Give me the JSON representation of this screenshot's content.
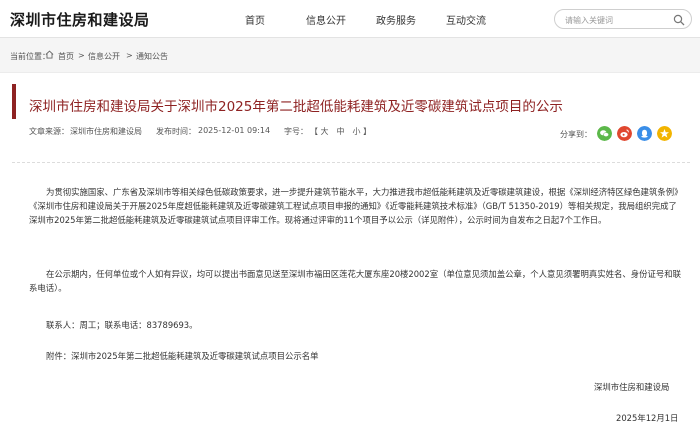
{
  "header": {
    "site_title": "深圳市住房和建设局",
    "nav": [
      "首页",
      "信息公开",
      "政务服务",
      "互动交流"
    ],
    "search_placeholder": "请输入关键词"
  },
  "breadcrumb": {
    "label": "当前位置：",
    "items": [
      "首页",
      "信息公开",
      "通知公告"
    ],
    "separator": ">"
  },
  "article": {
    "title": "深圳市住房和建设局关于深圳市2025年第二批超低能耗建筑及近零碳建筑试点项目的公示",
    "source_label": "文章来源：",
    "source": "深圳市住房和建设局",
    "time_label": "发布时间：",
    "time": "2025-12-01 09:14",
    "font_label": "字号：",
    "font_sizes": "【 大　中　小 】",
    "share_label": "分享到：",
    "paragraphs": [
      "为贯彻实施国家、广东省及深圳市等相关绿色低碳政策要求，进一步提升建筑节能水平，大力推进我市超低能耗建筑及近零碳建筑建设，根据《深圳经济特区绿色建筑条例》《深圳市住房和建设局关于开展2025年度超低能耗建筑及近零碳建筑工程试点项目申报的通知》《近零能耗建筑技术标准》（GB/T 51350-2019）等相关规定，我局组织完成了深圳市2025年第二批超低能耗建筑及近零碳建筑试点项目评审工作。现将通过评审的11个项目予以公示（详见附件），公示时间为自发布之日起7个工作日。",
      "在公示期内，任何单位或个人如有异议，均可以提出书面意见送至深圳市福田区莲花大厦东座20楼2002室（单位意见须加盖公章，个人意见须署明真实姓名、身份证号和联系电话）。",
      "联系人：周工；联系电话：83789693。",
      "附件：深圳市2025年第二批超低能耗建筑及近零碳建筑试点项目公示名单"
    ],
    "signer": "深圳市住房和建设局",
    "date": "2025年12月1日"
  },
  "share_icons": [
    "wechat-icon",
    "weibo-icon",
    "qq-icon",
    "qzone-icon"
  ],
  "colors": {
    "title_red": "#8e2222",
    "wechat": "#5cb84a",
    "weibo": "#e0472f",
    "qq": "#3a8ee8",
    "qzone": "#f2b400"
  }
}
